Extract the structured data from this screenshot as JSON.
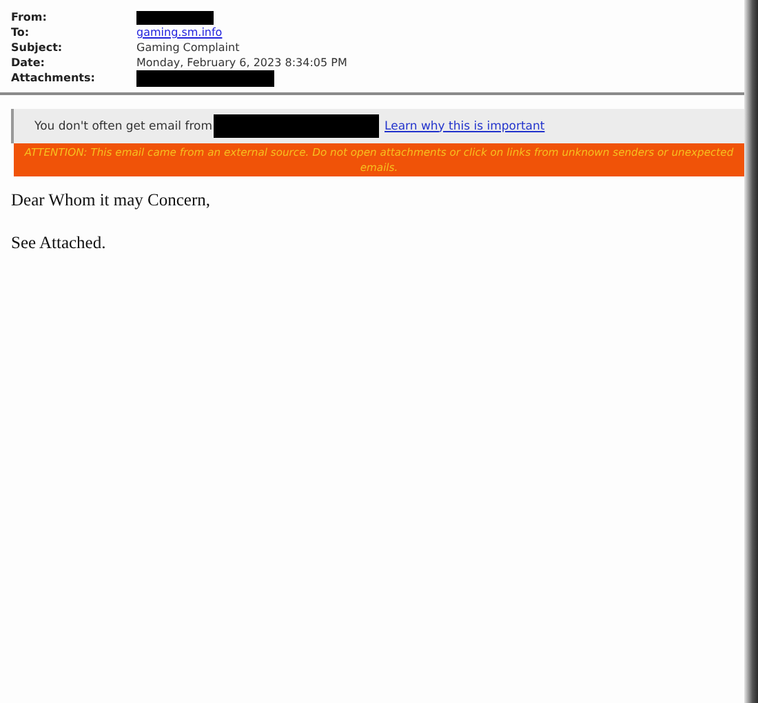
{
  "header": [
    {
      "label": "From:",
      "kind": "redacted"
    },
    {
      "label": "To:",
      "kind": "link",
      "value": "gaming.sm.info"
    },
    {
      "label": "Subject:",
      "kind": "text",
      "value": "Gaming Complaint"
    },
    {
      "label": "Date:",
      "kind": "text",
      "value": "Monday, February 6, 2023 8:34:05 PM"
    },
    {
      "label": "Attachments:",
      "kind": "redacted"
    }
  ],
  "sender_notice": {
    "text": "You don't often get email from",
    "sender_redacted": true,
    "link": "Learn why this is important"
  },
  "warning": "ATTENTION: This email came from an external source. Do not open attachments or click on links from unknown senders or unexpected emails.",
  "body": [
    "Dear Whom it may Concern,",
    "See Attached."
  ]
}
